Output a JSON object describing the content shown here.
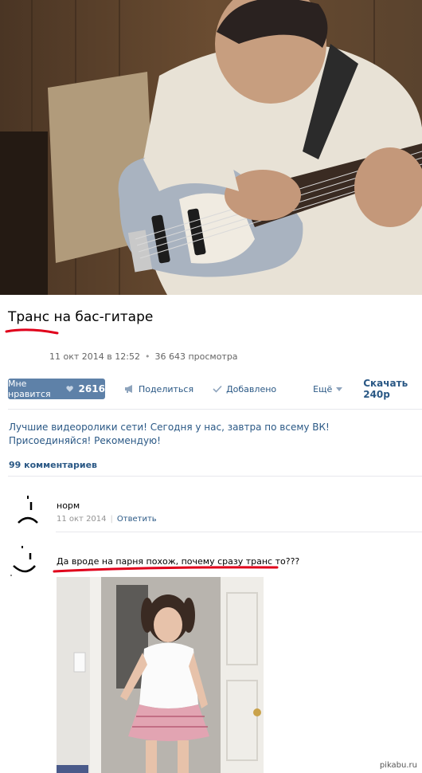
{
  "video": {
    "title": "Транс на бас-гитаре",
    "date": "11 окт 2014 в 12:52",
    "views": "36 643 просмотра"
  },
  "actions": {
    "like_label": "Мне нравится",
    "like_count": "2616",
    "share_label": "Поделиться",
    "added_label": "Добавлено",
    "more_label": "Ещё",
    "download_label": "Скачать 240p"
  },
  "description": "Лучшие видеоролики сети! Сегодня у нас, завтра по всему ВК! Присоединяйся! Рекомендую!",
  "comments": {
    "count_label": "99 комментариев",
    "items": [
      {
        "text": "норм",
        "date": "11 окт 2014",
        "reply": "Ответить"
      },
      {
        "text": "Да вроде на парня похож, почему сразу транс то???"
      }
    ]
  },
  "watermark": "pikabu.ru",
  "colors": {
    "accent": "#5e81a8",
    "link": "#2a5885",
    "highlight": "#e0001b"
  }
}
